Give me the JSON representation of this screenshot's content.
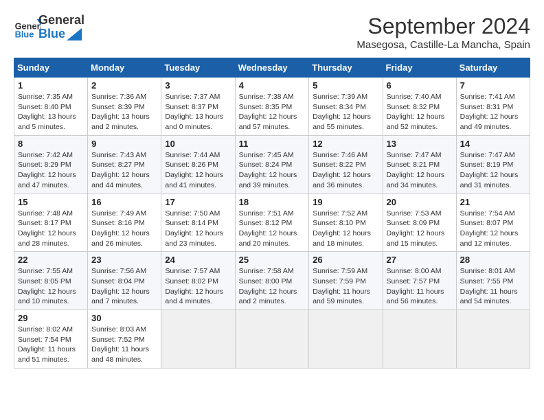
{
  "header": {
    "logo_general": "General",
    "logo_blue": "Blue",
    "month_title": "September 2024",
    "location": "Masegosa, Castille-La Mancha, Spain"
  },
  "days_of_week": [
    "Sunday",
    "Monday",
    "Tuesday",
    "Wednesday",
    "Thursday",
    "Friday",
    "Saturday"
  ],
  "weeks": [
    [
      {
        "day": 1,
        "info": "Sunrise: 7:35 AM\nSunset: 8:40 PM\nDaylight: 13 hours and 5 minutes."
      },
      {
        "day": 2,
        "info": "Sunrise: 7:36 AM\nSunset: 8:39 PM\nDaylight: 13 hours and 2 minutes."
      },
      {
        "day": 3,
        "info": "Sunrise: 7:37 AM\nSunset: 8:37 PM\nDaylight: 13 hours and 0 minutes."
      },
      {
        "day": 4,
        "info": "Sunrise: 7:38 AM\nSunset: 8:35 PM\nDaylight: 12 hours and 57 minutes."
      },
      {
        "day": 5,
        "info": "Sunrise: 7:39 AM\nSunset: 8:34 PM\nDaylight: 12 hours and 55 minutes."
      },
      {
        "day": 6,
        "info": "Sunrise: 7:40 AM\nSunset: 8:32 PM\nDaylight: 12 hours and 52 minutes."
      },
      {
        "day": 7,
        "info": "Sunrise: 7:41 AM\nSunset: 8:31 PM\nDaylight: 12 hours and 49 minutes."
      }
    ],
    [
      {
        "day": 8,
        "info": "Sunrise: 7:42 AM\nSunset: 8:29 PM\nDaylight: 12 hours and 47 minutes."
      },
      {
        "day": 9,
        "info": "Sunrise: 7:43 AM\nSunset: 8:27 PM\nDaylight: 12 hours and 44 minutes."
      },
      {
        "day": 10,
        "info": "Sunrise: 7:44 AM\nSunset: 8:26 PM\nDaylight: 12 hours and 41 minutes."
      },
      {
        "day": 11,
        "info": "Sunrise: 7:45 AM\nSunset: 8:24 PM\nDaylight: 12 hours and 39 minutes."
      },
      {
        "day": 12,
        "info": "Sunrise: 7:46 AM\nSunset: 8:22 PM\nDaylight: 12 hours and 36 minutes."
      },
      {
        "day": 13,
        "info": "Sunrise: 7:47 AM\nSunset: 8:21 PM\nDaylight: 12 hours and 34 minutes."
      },
      {
        "day": 14,
        "info": "Sunrise: 7:47 AM\nSunset: 8:19 PM\nDaylight: 12 hours and 31 minutes."
      }
    ],
    [
      {
        "day": 15,
        "info": "Sunrise: 7:48 AM\nSunset: 8:17 PM\nDaylight: 12 hours and 28 minutes."
      },
      {
        "day": 16,
        "info": "Sunrise: 7:49 AM\nSunset: 8:16 PM\nDaylight: 12 hours and 26 minutes."
      },
      {
        "day": 17,
        "info": "Sunrise: 7:50 AM\nSunset: 8:14 PM\nDaylight: 12 hours and 23 minutes."
      },
      {
        "day": 18,
        "info": "Sunrise: 7:51 AM\nSunset: 8:12 PM\nDaylight: 12 hours and 20 minutes."
      },
      {
        "day": 19,
        "info": "Sunrise: 7:52 AM\nSunset: 8:10 PM\nDaylight: 12 hours and 18 minutes."
      },
      {
        "day": 20,
        "info": "Sunrise: 7:53 AM\nSunset: 8:09 PM\nDaylight: 12 hours and 15 minutes."
      },
      {
        "day": 21,
        "info": "Sunrise: 7:54 AM\nSunset: 8:07 PM\nDaylight: 12 hours and 12 minutes."
      }
    ],
    [
      {
        "day": 22,
        "info": "Sunrise: 7:55 AM\nSunset: 8:05 PM\nDaylight: 12 hours and 10 minutes."
      },
      {
        "day": 23,
        "info": "Sunrise: 7:56 AM\nSunset: 8:04 PM\nDaylight: 12 hours and 7 minutes."
      },
      {
        "day": 24,
        "info": "Sunrise: 7:57 AM\nSunset: 8:02 PM\nDaylight: 12 hours and 4 minutes."
      },
      {
        "day": 25,
        "info": "Sunrise: 7:58 AM\nSunset: 8:00 PM\nDaylight: 12 hours and 2 minutes."
      },
      {
        "day": 26,
        "info": "Sunrise: 7:59 AM\nSunset: 7:59 PM\nDaylight: 11 hours and 59 minutes."
      },
      {
        "day": 27,
        "info": "Sunrise: 8:00 AM\nSunset: 7:57 PM\nDaylight: 11 hours and 56 minutes."
      },
      {
        "day": 28,
        "info": "Sunrise: 8:01 AM\nSunset: 7:55 PM\nDaylight: 11 hours and 54 minutes."
      }
    ],
    [
      {
        "day": 29,
        "info": "Sunrise: 8:02 AM\nSunset: 7:54 PM\nDaylight: 11 hours and 51 minutes."
      },
      {
        "day": 30,
        "info": "Sunrise: 8:03 AM\nSunset: 7:52 PM\nDaylight: 11 hours and 48 minutes."
      },
      null,
      null,
      null,
      null,
      null
    ]
  ]
}
